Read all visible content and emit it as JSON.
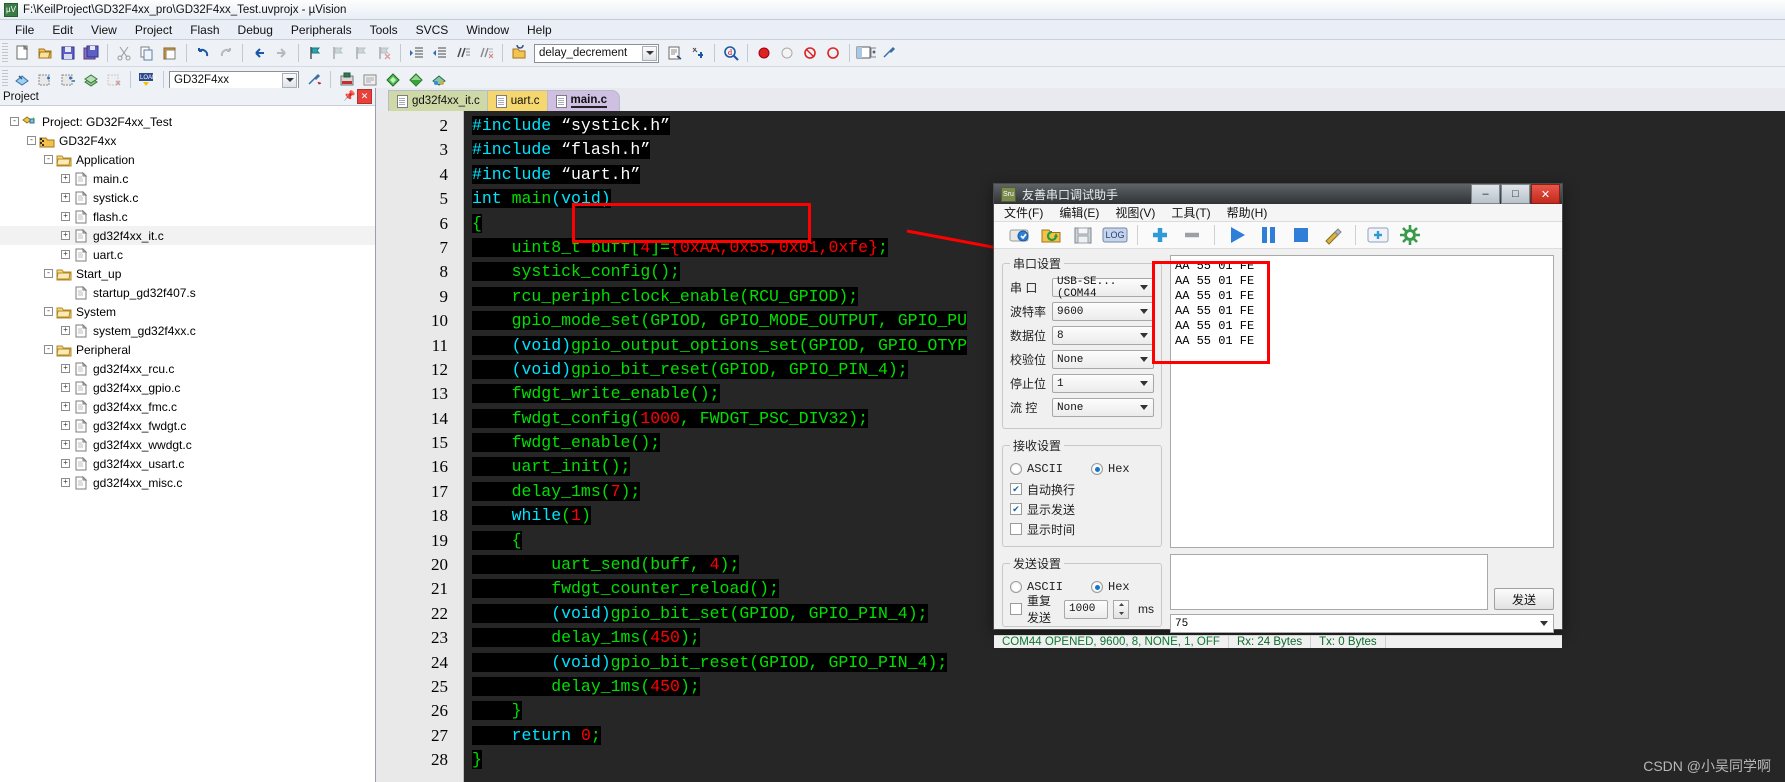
{
  "window": {
    "title": "F:\\KeilProject\\GD32F4xx_pro\\GD32F4xx_Test.uvprojx - µVision",
    "app_icon": "uvision-icon"
  },
  "menubar": [
    "File",
    "Edit",
    "View",
    "Project",
    "Flash",
    "Debug",
    "Peripherals",
    "Tools",
    "SVCS",
    "Window",
    "Help"
  ],
  "toolbar1": {
    "target_combo_value": "delay_decrement"
  },
  "toolbar2": {
    "target_combo_value": "GD32F4xx"
  },
  "project_pane": {
    "header": "Project",
    "tree": [
      {
        "label": "Project: GD32F4xx_Test",
        "indent": 0,
        "expander": "-",
        "icon": "project-icon"
      },
      {
        "label": "GD32F4xx",
        "indent": 1,
        "expander": "-",
        "icon": "target-icon"
      },
      {
        "label": "Application",
        "indent": 2,
        "expander": "-",
        "icon": "folder-icon"
      },
      {
        "label": "main.c",
        "indent": 3,
        "expander": "+",
        "icon": "file-icon"
      },
      {
        "label": "systick.c",
        "indent": 3,
        "expander": "+",
        "icon": "file-icon"
      },
      {
        "label": "flash.c",
        "indent": 3,
        "expander": "+",
        "icon": "file-icon"
      },
      {
        "label": "gd32f4xx_it.c",
        "indent": 3,
        "expander": "+",
        "icon": "file-icon",
        "selected": true
      },
      {
        "label": "uart.c",
        "indent": 3,
        "expander": "+",
        "icon": "file-icon"
      },
      {
        "label": "Start_up",
        "indent": 2,
        "expander": "-",
        "icon": "folder-icon"
      },
      {
        "label": "startup_gd32f407.s",
        "indent": 3,
        "expander": "",
        "icon": "file-icon"
      },
      {
        "label": "System",
        "indent": 2,
        "expander": "-",
        "icon": "folder-icon"
      },
      {
        "label": "system_gd32f4xx.c",
        "indent": 3,
        "expander": "+",
        "icon": "file-icon"
      },
      {
        "label": "Peripheral",
        "indent": 2,
        "expander": "-",
        "icon": "folder-icon"
      },
      {
        "label": "gd32f4xx_rcu.c",
        "indent": 3,
        "expander": "+",
        "icon": "file-icon"
      },
      {
        "label": "gd32f4xx_gpio.c",
        "indent": 3,
        "expander": "+",
        "icon": "file-icon"
      },
      {
        "label": "gd32f4xx_fmc.c",
        "indent": 3,
        "expander": "+",
        "icon": "file-icon"
      },
      {
        "label": "gd32f4xx_fwdgt.c",
        "indent": 3,
        "expander": "+",
        "icon": "file-icon"
      },
      {
        "label": "gd32f4xx_wwdgt.c",
        "indent": 3,
        "expander": "+",
        "icon": "file-icon"
      },
      {
        "label": "gd32f4xx_usart.c",
        "indent": 3,
        "expander": "+",
        "icon": "file-icon"
      },
      {
        "label": "gd32f4xx_misc.c",
        "indent": 3,
        "expander": "+",
        "icon": "file-icon"
      }
    ]
  },
  "editor": {
    "tabs": [
      {
        "label": "gd32f4xx_it.c",
        "active": false
      },
      {
        "label": "uart.c",
        "active": false
      },
      {
        "label": "main.c",
        "active": true
      }
    ],
    "first_line_number": 2,
    "lines": [
      {
        "n": "2",
        "fold": "",
        "tokens": [
          [
            "kw",
            "#include"
          ],
          [
            "wht",
            " “systick.h”"
          ]
        ]
      },
      {
        "n": "3",
        "fold": "",
        "tokens": [
          [
            "kw",
            "#include"
          ],
          [
            "wht",
            " “flash.h”"
          ]
        ]
      },
      {
        "n": "4",
        "fold": "",
        "tokens": [
          [
            "kw",
            "#include"
          ],
          [
            "wht",
            " “uart.h”"
          ]
        ]
      },
      {
        "n": "5",
        "fold": "",
        "tokens": [
          [
            "kw",
            "int"
          ],
          [
            "grn",
            " main"
          ],
          [
            "kw",
            "(void)"
          ]
        ]
      },
      {
        "n": "6",
        "fold": "-",
        "tokens": [
          [
            "grn",
            "{"
          ]
        ]
      },
      {
        "n": "7",
        "fold": "",
        "tokens": [
          [
            "grn",
            "    uint8_t buff["
          ],
          [
            "red",
            "4"
          ],
          [
            "grn",
            "]="
          ],
          [
            "red",
            "{0xAA,0x55,0x01,0xfe}"
          ],
          [
            "grn",
            ";"
          ]
        ]
      },
      {
        "n": "8",
        "fold": "",
        "tokens": [
          [
            "grn",
            "    systick_config();"
          ]
        ]
      },
      {
        "n": "9",
        "fold": "",
        "tokens": [
          [
            "grn",
            "    rcu_periph_clock_enable(RCU_GPIOD);"
          ]
        ]
      },
      {
        "n": "10",
        "fold": "",
        "tokens": [
          [
            "grn",
            "    gpio_mode_set(GPIOD, GPIO_MODE_OUTPUT, GPIO_PU"
          ]
        ]
      },
      {
        "n": "11",
        "fold": "",
        "tokens": [
          [
            "grn",
            "    "
          ],
          [
            "kw",
            "(void)"
          ],
          [
            "grn",
            "gpio_output_options_set(GPIOD, GPIO_OTYP"
          ]
        ]
      },
      {
        "n": "12",
        "fold": "",
        "tokens": [
          [
            "grn",
            "    "
          ],
          [
            "kw",
            "(void)"
          ],
          [
            "grn",
            "gpio_bit_reset(GPIOD, GPIO_PIN_4);"
          ]
        ]
      },
      {
        "n": "13",
        "fold": "",
        "tokens": [
          [
            "grn",
            "    fwdgt_write_enable();"
          ]
        ]
      },
      {
        "n": "14",
        "fold": "",
        "tokens": [
          [
            "grn",
            "    fwdgt_config("
          ],
          [
            "red",
            "1000"
          ],
          [
            "grn",
            ", FWDGT_PSC_DIV32);"
          ]
        ]
      },
      {
        "n": "15",
        "fold": "",
        "tokens": [
          [
            "grn",
            "    fwdgt_enable();"
          ]
        ]
      },
      {
        "n": "16",
        "fold": "",
        "tokens": [
          [
            "grn",
            "    uart_init();"
          ]
        ]
      },
      {
        "n": "17",
        "fold": "",
        "tokens": [
          [
            "grn",
            "    delay_1ms("
          ],
          [
            "red",
            "7"
          ],
          [
            "grn",
            ");"
          ]
        ]
      },
      {
        "n": "18",
        "fold": "",
        "tokens": [
          [
            "kw",
            "    while"
          ],
          [
            "grn",
            "("
          ],
          [
            "red",
            "1"
          ],
          [
            "grn",
            ")"
          ]
        ]
      },
      {
        "n": "19",
        "fold": "-",
        "tokens": [
          [
            "grn",
            "    {"
          ]
        ]
      },
      {
        "n": "20",
        "fold": "",
        "tokens": [
          [
            "grn",
            "        uart_send(buff, "
          ],
          [
            "red",
            "4"
          ],
          [
            "grn",
            ");"
          ]
        ]
      },
      {
        "n": "21",
        "fold": "",
        "tokens": [
          [
            "grn",
            "        fwdgt_counter_reload();"
          ]
        ]
      },
      {
        "n": "22",
        "fold": "",
        "tokens": [
          [
            "grn",
            "        "
          ],
          [
            "kw",
            "(void)"
          ],
          [
            "grn",
            "gpio_bit_set(GPIOD, GPIO_PIN_4);"
          ]
        ]
      },
      {
        "n": "23",
        "fold": "",
        "tokens": [
          [
            "grn",
            "        delay_1ms("
          ],
          [
            "red",
            "450"
          ],
          [
            "grn",
            ");"
          ]
        ]
      },
      {
        "n": "24",
        "fold": "",
        "tokens": [
          [
            "grn",
            "        "
          ],
          [
            "kw",
            "(void)"
          ],
          [
            "grn",
            "gpio_bit_reset(GPIOD, GPIO_PIN_4);"
          ]
        ]
      },
      {
        "n": "25",
        "fold": "",
        "tokens": [
          [
            "grn",
            "        delay_1ms("
          ],
          [
            "red",
            "450"
          ],
          [
            "grn",
            ");"
          ]
        ]
      },
      {
        "n": "26",
        "fold": "",
        "tokens": [
          [
            "grn",
            "    }"
          ]
        ]
      },
      {
        "n": "27",
        "fold": "",
        "tokens": [
          [
            "kw",
            "    return"
          ],
          [
            "grn",
            " "
          ],
          [
            "red",
            "0"
          ],
          [
            "grn",
            ";"
          ]
        ]
      },
      {
        "n": "28",
        "fold": "",
        "tokens": [
          [
            "grn",
            "}"
          ]
        ]
      }
    ],
    "highlight_color": "#ff0000"
  },
  "serial_dialog": {
    "title": "友善串口调试助手",
    "window_buttons": {
      "minimize": "–",
      "maximize": "□",
      "close": "✕"
    },
    "menu": [
      "文件(F)",
      "编辑(E)",
      "视图(V)",
      "工具(T)",
      "帮助(H)"
    ],
    "toolbar_icons": [
      "connect-icon",
      "open-folder-icon",
      "save-icon",
      "log-icon",
      "add-icon",
      "remove-icon",
      "play-icon",
      "pause-icon",
      "stop-icon",
      "clear-icon",
      "new-tab-icon",
      "settings-icon"
    ],
    "port_settings": {
      "legend": "串口设置",
      "fields": [
        {
          "label": "串  口",
          "value": "USB-SE... (COM44"
        },
        {
          "label": "波特率",
          "value": "9600"
        },
        {
          "label": "数据位",
          "value": "8"
        },
        {
          "label": "校验位",
          "value": "None"
        },
        {
          "label": "停止位",
          "value": "1"
        },
        {
          "label": "流  控",
          "value": "None"
        }
      ]
    },
    "recv_settings": {
      "legend": "接收设置",
      "radio_ascii": "ASCII",
      "radio_hex": "Hex",
      "radio_selected": "Hex",
      "checkboxes": [
        {
          "label": "自动换行",
          "checked": true
        },
        {
          "label": "显示发送",
          "checked": true
        },
        {
          "label": "显示时间",
          "checked": false
        }
      ]
    },
    "send_settings": {
      "legend": "发送设置",
      "radio_ascii": "ASCII",
      "radio_hex": "Hex",
      "radio_selected": "Hex",
      "repeat_label": "重复发送",
      "repeat_checked": false,
      "repeat_value": "1000",
      "repeat_unit": "ms"
    },
    "received_lines": [
      "AA 55 01 FE",
      "AA 55 01 FE",
      "AA 55 01 FE",
      "AA 55 01 FE",
      "AA 55 01 FE",
      "AA 55 01 FE"
    ],
    "send_text": "",
    "send_history_value": "75",
    "send_button": "发送",
    "status": {
      "connection": "COM44 OPENED, 9600, 8, NONE, 1, OFF",
      "rx": "Rx: 24 Bytes",
      "tx": "Tx: 0 Bytes"
    }
  },
  "watermark": "CSDN @小吴同学啊",
  "colors": {
    "accent_red": "#ff0000",
    "code_bg": "#262626",
    "code_green": "#00e000",
    "code_cyan": "#00e5ff"
  }
}
